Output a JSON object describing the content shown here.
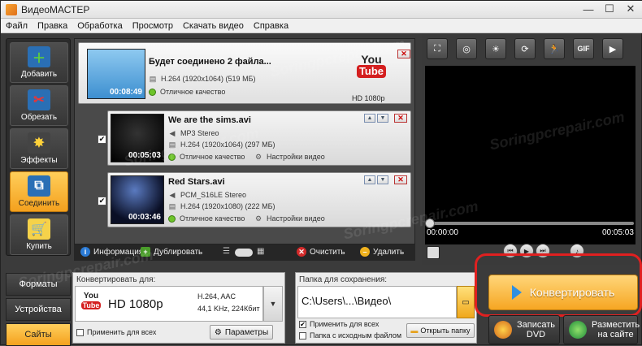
{
  "window": {
    "title": "ВидеоМАСТЕР",
    "minimize": "—",
    "maximize": "☐",
    "close": "✕"
  },
  "menu": [
    "Файл",
    "Правка",
    "Обработка",
    "Просмотр",
    "Скачать видео",
    "Справка"
  ],
  "left_toolbar": [
    {
      "label": "Добавить",
      "icon": "film-plus-icon"
    },
    {
      "label": "Обрезать",
      "icon": "film-scissors-icon"
    },
    {
      "label": "Эффекты",
      "icon": "sparkle-icon"
    },
    {
      "label": "Соединить",
      "icon": "merge-icon",
      "active": true
    },
    {
      "label": "Купить",
      "icon": "cart-tag-icon"
    }
  ],
  "group": {
    "title": "Будет соединено 2 файла...",
    "duration": "00:08:49",
    "video": "H.264 (1920x1064) (519 МБ)",
    "quality": "Отличное качество",
    "format_label": "HD 1080p"
  },
  "files": [
    {
      "name": "We are the sims.avi",
      "duration": "00:05:03",
      "audio": "MP3 Stereo",
      "video": "H.264 (1920x1064) (297 МБ)",
      "quality": "Отличное качество",
      "settings": "Настройки видео",
      "checked": "✔"
    },
    {
      "name": "Red Stars.avi",
      "duration": "00:03:46",
      "audio": "PCM_S16LE Stereo",
      "video": "H.264 (1920x1080) (222 МБ)",
      "quality": "Отличное качество",
      "settings": "Настройки видео",
      "checked": "✔"
    }
  ],
  "list_toolbar": {
    "info": "Информация",
    "duplicate": "Дублировать",
    "clear": "Очистить",
    "delete": "Удалить"
  },
  "preview": {
    "tools": [
      "crop-icon",
      "stabilize-icon",
      "brightness-icon",
      "rotate-icon",
      "speed-icon",
      "GIF",
      "play-frame-icon"
    ],
    "gif_label": "GIF",
    "time_start": "00:00:00",
    "time_end": "00:05:03"
  },
  "tabs": [
    {
      "label": "Форматы"
    },
    {
      "label": "Устройства"
    },
    {
      "label": "Сайты",
      "active": true
    }
  ],
  "convert_panel": {
    "title": "Конвертировать для:",
    "format": "HD 1080p",
    "codec": "H.264, AAC",
    "audio": "44,1 KHz, 224Кбит",
    "apply_all": "Применить для всех",
    "params": "Параметры"
  },
  "save_panel": {
    "title": "Папка для сохранения:",
    "path": "C:\\Users\\...\\Видео\\",
    "apply_all": "Применить для всех",
    "source_folder": "Папка с исходным файлом",
    "open_folder": "Открыть папку"
  },
  "actions": {
    "convert": "Конвертировать",
    "dvd_line1": "Записать",
    "dvd_line2": "DVD",
    "site_line1": "Разместить",
    "site_line2": "на сайте"
  },
  "youtube": {
    "you": "You",
    "tube": "Tube",
    "hd": "HD"
  },
  "watermark": "Soringpcrepair.com"
}
